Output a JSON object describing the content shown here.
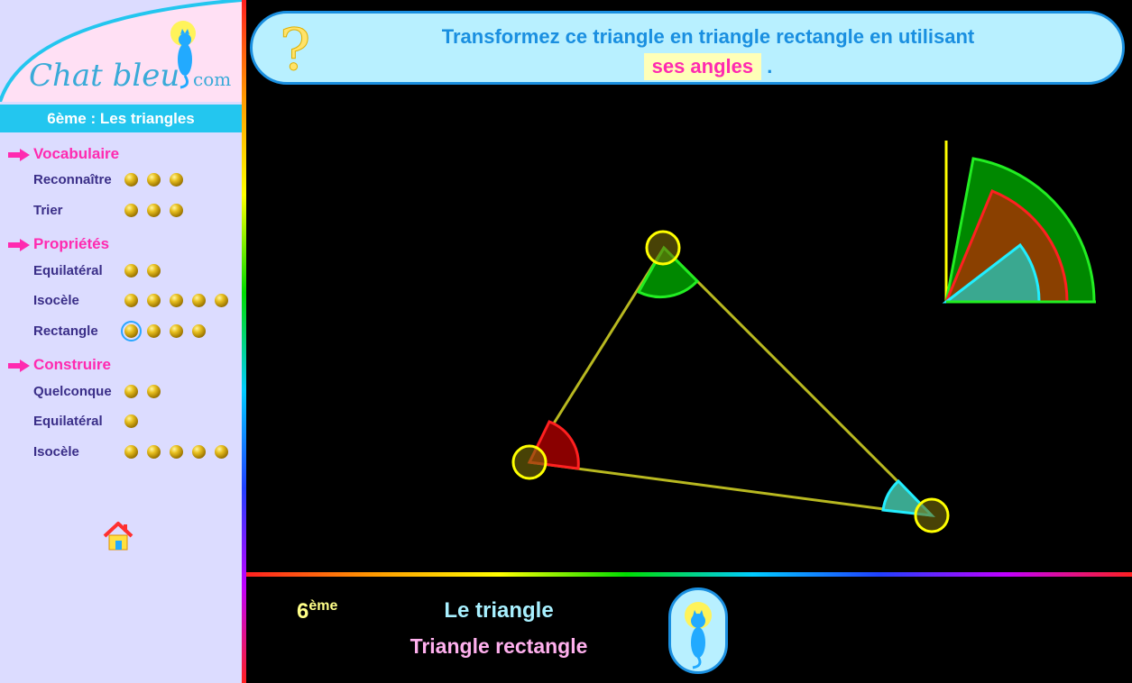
{
  "logo": {
    "text": "Chat bleu",
    "suffix": "com"
  },
  "sidebar": {
    "header": "6ème : Les triangles",
    "sections": [
      {
        "label": "Vocabulaire",
        "items": [
          {
            "label": "Reconnaître",
            "dots": 3
          },
          {
            "label": "Trier",
            "dots": 3
          }
        ]
      },
      {
        "label": "Propriétés",
        "items": [
          {
            "label": "Equilatéral",
            "dots": 2
          },
          {
            "label": "Isocèle",
            "dots": 5
          },
          {
            "label": "Rectangle",
            "dots": 4,
            "selected_dot": 1
          }
        ]
      },
      {
        "label": "Construire",
        "items": [
          {
            "label": "Quelconque",
            "dots": 2
          },
          {
            "label": "Equilatéral",
            "dots": 1
          },
          {
            "label": "Isocèle",
            "dots": 5
          }
        ]
      }
    ]
  },
  "banner": {
    "question_glyph": "?",
    "line1": "Transformez ce triangle en triangle rectangle en utilisant",
    "highlight": "ses angles",
    "tail": "."
  },
  "footer": {
    "grade": "6",
    "grade_sup": "ème",
    "chapter": "Le triangle",
    "subchapter": "Triangle rectangle"
  },
  "colors": {
    "angle_top": "#008800",
    "angle_left": "#8a0000",
    "angle_right": "#3aa890",
    "triangle_side": "#b8b820",
    "handle": "#ffff00",
    "accent": "#1a8fe0",
    "section": "#ff2ab0"
  }
}
